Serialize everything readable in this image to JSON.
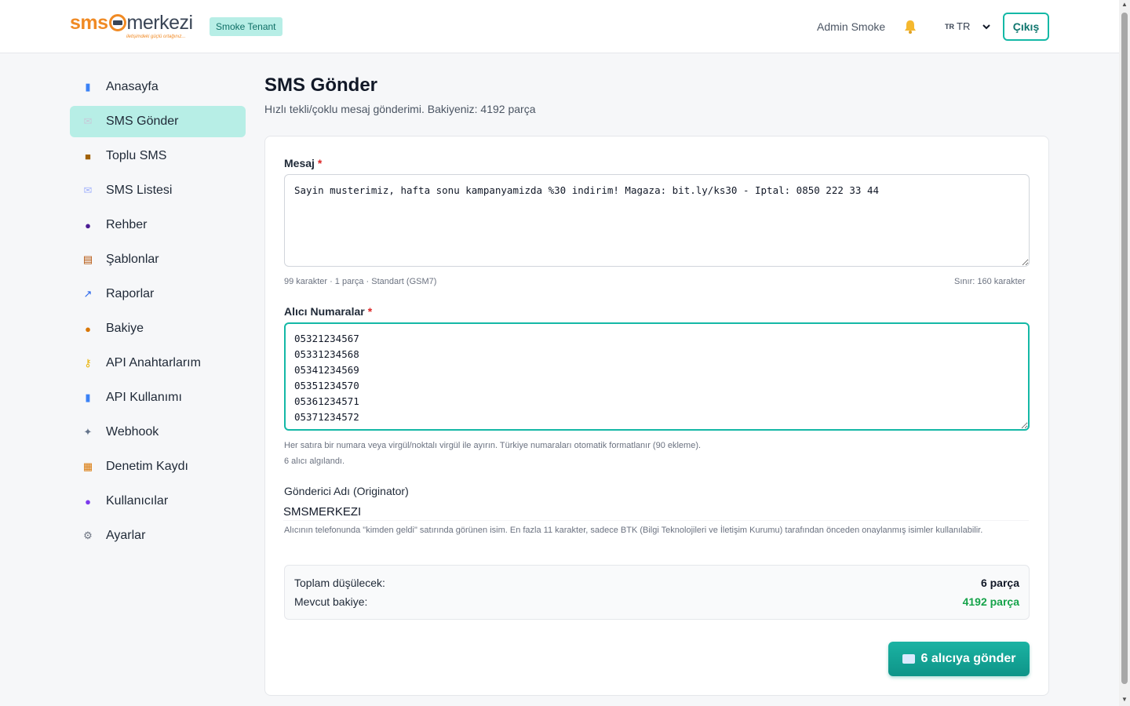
{
  "header": {
    "logo_sms": "sms",
    "logo_merkezi": "merkezi",
    "logo_tagline": "iletişimdeki güçlü ortağınız...",
    "tenant_badge": "Smoke Tenant",
    "user_name": "Admin Smoke",
    "lang_flag": "TR",
    "lang_label": "TR",
    "logout_label": "Çıkış"
  },
  "sidebar": {
    "items": [
      {
        "label": "Anasayfa",
        "icon": "bar-chart-icon",
        "active": false
      },
      {
        "label": "SMS Gönder",
        "icon": "envelope-icon",
        "active": true
      },
      {
        "label": "Toplu SMS",
        "icon": "package-icon",
        "active": false
      },
      {
        "label": "SMS Listesi",
        "icon": "envelope-list-icon",
        "active": false
      },
      {
        "label": "Rehber",
        "icon": "contacts-icon",
        "active": false
      },
      {
        "label": "Şablonlar",
        "icon": "clipboard-icon",
        "active": false
      },
      {
        "label": "Raporlar",
        "icon": "line-chart-icon",
        "active": false
      },
      {
        "label": "Bakiye",
        "icon": "money-bag-icon",
        "active": false
      },
      {
        "label": "API Anahtarlarım",
        "icon": "key-icon",
        "active": false
      },
      {
        "label": "API Kullanımı",
        "icon": "bar-chart-icon",
        "active": false
      },
      {
        "label": "Webhook",
        "icon": "satellite-icon",
        "active": false
      },
      {
        "label": "Denetim Kaydı",
        "icon": "scroll-icon",
        "active": false
      },
      {
        "label": "Kullanıcılar",
        "icon": "user-icon",
        "active": false
      },
      {
        "label": "Ayarlar",
        "icon": "gear-icon",
        "active": false
      }
    ]
  },
  "page": {
    "title": "SMS Gönder",
    "subtitle": "Hızlı tekli/çoklu mesaj gönderimi. Bakiyeniz: 4192 parça"
  },
  "form": {
    "message_label": "Mesaj",
    "required_mark": "*",
    "message_value": "Sayin musterimiz, hafta sonu kampanyamizda %30 indirim! Magaza: bit.ly/ks30 - Iptal: 0850 222 33 44",
    "message_stats": "99 karakter · 1 parça · Standart (GSM7)",
    "message_limit": "Sınır: 160 karakter",
    "recipients_label": "Alıcı Numaralar",
    "recipients_value": "05321234567\n05331234568\n05341234569\n05351234570\n05361234571\n05371234572",
    "recipients_hint": "Her satıra bir numara veya virgül/noktalı virgül ile ayırın. Türkiye numaraları otomatik formatlanır (90 ekleme).",
    "recipients_detected": "6 alıcı algılandı.",
    "originator_label": "Gönderici Adı (Originator)",
    "originator_value": "SMSMERKEZI",
    "originator_hint": "Alıcının telefonunda \"kimden geldi\" satırında görünen isim. En fazla 11 karakter, sadece BTK (Bilgi Teknolojileri ve İletişim Kurumu) tarafından önceden onaylanmış isimler kullanılabilir."
  },
  "summary": {
    "total_label": "Toplam düşülecek:",
    "total_value": "6 parça",
    "balance_label": "Mevcut bakiye:",
    "balance_value": "4192 parça",
    "balance_color": "#16a34a"
  },
  "send_button": {
    "label": "6 alıcıya gönder",
    "icon": "envelope-icon"
  },
  "colors": {
    "accent": "#14b8a6",
    "active_nav": "#b7eee6",
    "brand_orange": "#f08a24"
  }
}
